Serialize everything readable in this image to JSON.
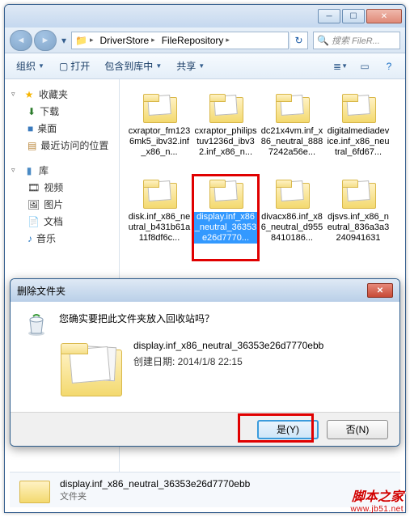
{
  "window": {
    "path_segments": [
      "DriverStore",
      "FileRepository"
    ],
    "search_placeholder": "搜索 FileR..."
  },
  "toolbar": {
    "organize": "组织",
    "open": "打开",
    "include": "包含到库中",
    "share": "共享"
  },
  "sidebar": {
    "favorites": {
      "header": "收藏夹",
      "items": [
        "下载",
        "桌面",
        "最近访问的位置"
      ]
    },
    "libraries": {
      "header": "库",
      "items": [
        "视频",
        "图片",
        "文档",
        "音乐"
      ]
    }
  },
  "folders": [
    {
      "label": "cxraptor_fm1236mk5_ibv32.inf_x86_n..."
    },
    {
      "label": "cxraptor_philipstuv1236d_ibv32.inf_x86_n..."
    },
    {
      "label": "dc21x4vm.inf_x86_neutral_8887242a56e..."
    },
    {
      "label": "digitalmediadevice.inf_x86_neutral_6fd67..."
    },
    {
      "label": "disk.inf_x86_neutral_b431b61a11f8df6c..."
    },
    {
      "label": "display.inf_x86_neutral_36353e26d7770...",
      "selected": true
    },
    {
      "label": "divacx86.inf_x86_neutral_d9558410186..."
    },
    {
      "label": "djsvs.inf_x86_neutral_836a3a3240941631"
    }
  ],
  "dialog": {
    "title": "删除文件夹",
    "question": "您确实要把此文件夹放入回收站吗？",
    "filename": "display.inf_x86_neutral_36353e26d7770ebb",
    "date_label": "创建日期: 2014/1/8 22:15",
    "yes": "是(Y)",
    "no": "否(N)"
  },
  "status": {
    "name": "display.inf_x86_neutral_36353e26d7770ebb",
    "type": "文件夹"
  },
  "watermark": {
    "cn": "脚本之家",
    "en": "www.jb51.net"
  }
}
